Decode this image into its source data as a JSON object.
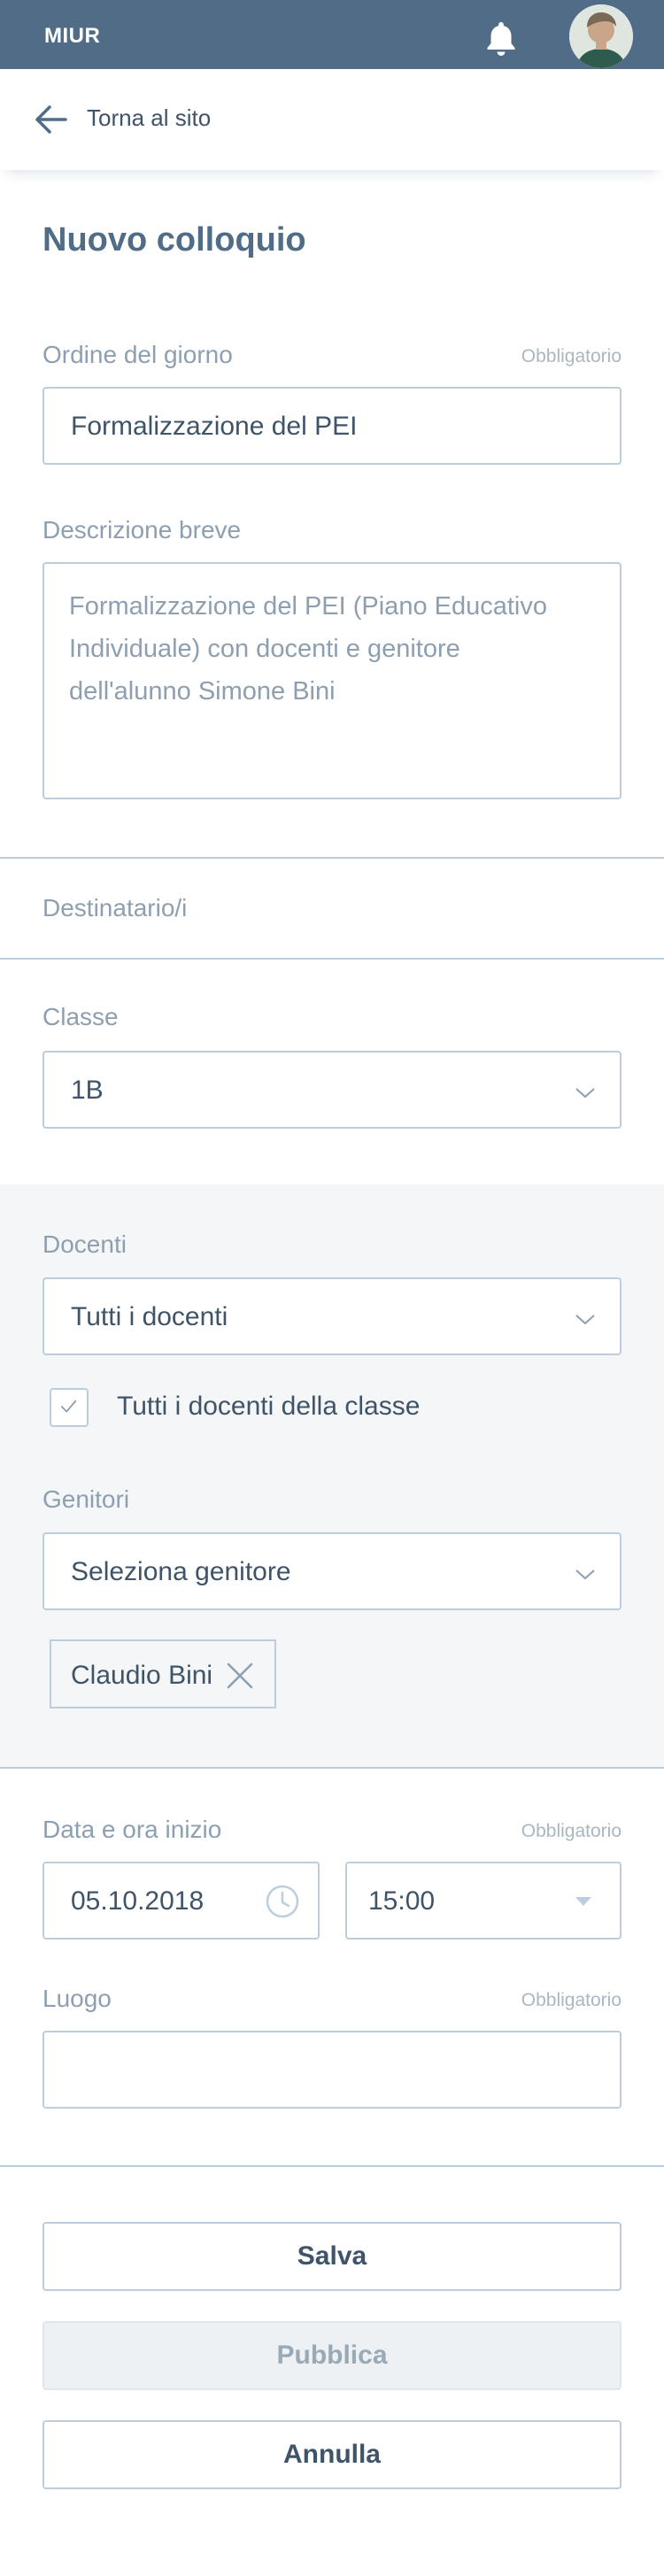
{
  "header": {
    "brand": "MIUR"
  },
  "back": {
    "label": "Torna al sito"
  },
  "page": {
    "title": "Nuovo colloquio"
  },
  "form": {
    "agenda": {
      "label": "Ordine del giorno",
      "required": "Obbligatorio",
      "value": "Formalizzazione del PEI"
    },
    "description": {
      "label": "Descrizione breve",
      "value": "Formalizzazione del PEI (Piano Educativo Individuale) con docenti e genitore dell'alunno Simone Bini"
    },
    "recipients": {
      "label": "Destinatario/i"
    },
    "class": {
      "label": "Classe",
      "value": "1B"
    },
    "teachers": {
      "label": "Docenti",
      "value": "Tutti i docenti",
      "all_label": "Tutti i docenti della classe",
      "all_checked": true
    },
    "parents": {
      "label": "Genitori",
      "placeholder": "Seleziona genitore",
      "selected": [
        "Claudio Bini"
      ]
    },
    "start": {
      "label": "Data e ora inizio",
      "required": "Obbligatorio",
      "date": "05.10.2018",
      "time": "15:00"
    },
    "place": {
      "label": "Luogo",
      "required": "Obbligatorio",
      "value": ""
    }
  },
  "actions": {
    "save": "Salva",
    "publish": "Pubblica",
    "cancel": "Annulla"
  },
  "colors": {
    "header_bg": "#506c86",
    "border": "#bccddd",
    "text": "#3f5468",
    "muted": "#8d9fb0",
    "gray_section": "#f5f6f7"
  },
  "icons": {
    "notifications": "bell-icon",
    "back": "arrow-left-icon",
    "dropdown": "chevron-down-icon",
    "clock": "clock-icon",
    "remove": "close-icon",
    "check": "checkmark-icon",
    "caret": "caret-down-icon"
  }
}
